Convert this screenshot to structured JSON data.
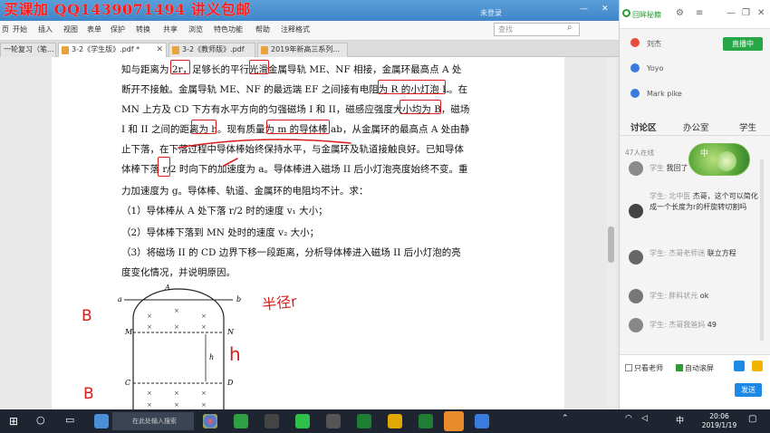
{
  "watermark": "买课加 QQ1439071494 讲义包邮",
  "title_bar": {
    "login": "未登录",
    "minimize": "—",
    "close": "✕"
  },
  "menu": [
    "页",
    "开始",
    "插入",
    "视图",
    "表单",
    "保护",
    "转换",
    "共享",
    "浏览",
    "特色功能",
    "帮助",
    "注释格式"
  ],
  "search_placeholder": "查找",
  "tabs": [
    {
      "label": "一轮复习（笔...",
      "active": false
    },
    {
      "label": "3-2《学生版》.pdf *",
      "active": true
    },
    {
      "label": "3-2《教师版》.pdf",
      "active": false
    },
    {
      "label": "2019年新高三系列...",
      "active": false
    }
  ],
  "document": {
    "lines": [
      "知与距离为 2r，足够长的平行光滑金属导轨 ME、NF 相接，金属环最高点 A 处",
      "断开不接触。金属导轨 ME、NF 的最远端 EF 之间接有电阻为 R 的小灯泡 L。在",
      "MN 上方及 CD 下方有水平方向的匀强磁场 I 和 II，磁感应强度大小均为 B，磁场",
      "I 和 II 之间的距离为 h。现有质量为 m 的导体棒 ab，从金属环的最高点 A 处由静",
      "止下落，在下落过程中导体棒始终保持水平，与金属环及轨道接触良好。已知导体",
      "体棒下落 r/2 时向下的加速度为 a。导体棒进入磁场 II 后小灯泡亮度始终不变。重",
      "力加速度为 g。导体棒、轨道、金属环的电阻均不计。求：",
      "（1）导体棒从 A 处下落 r/2 时的速度 v₁ 大小；",
      "（2）导体棒下落到 MN 处时的速度 v₂ 大小；",
      "（3）将磁场 II 的 CD 边界下移一段距离，分析导体棒进入磁场 II 后小灯泡的亮",
      "度变化情况，并说明原因。"
    ],
    "diagram_labels": {
      "a": "a",
      "b": "b",
      "A": "A",
      "M": "M",
      "N": "N",
      "C": "C",
      "D": "D",
      "h": "h"
    },
    "handwriting": {
      "B_top": "B",
      "B_bottom": "B",
      "radius_note": "半径r",
      "h_mark": "h"
    }
  },
  "panel": {
    "title": "回眸秘籍",
    "users": [
      {
        "name": "刘杰",
        "color": "#e74c3c",
        "live_label": "直播中"
      },
      {
        "name": "Yoyo",
        "color": "#3b7be0"
      },
      {
        "name": "Mark pike",
        "color": "#3b7be0"
      }
    ],
    "tabs": [
      "讨论区",
      "办公室",
      "学生"
    ],
    "online_count": "47人在线",
    "messages": [
      {
        "who": "学生",
        "text": "我回了"
      },
      {
        "who": "学生: 北中医",
        "text": "杰哥，这个可以简化成一个长度为r的杆旋转切割吗"
      },
      {
        "who": "学生: 杰哥老师迷",
        "text": "联立方程"
      },
      {
        "who": "学生: 胖料状元",
        "text": "ok"
      },
      {
        "who": "学生: 杰哥我爸妈",
        "text": "49"
      }
    ],
    "float_badge": "中",
    "only_teacher": "只看老师",
    "auto_scroll": "自动滚屏",
    "send": "发送"
  },
  "taskbar": {
    "time": "20:06",
    "date": "2019/1/19",
    "search_hint": "在此处输入搜索"
  }
}
